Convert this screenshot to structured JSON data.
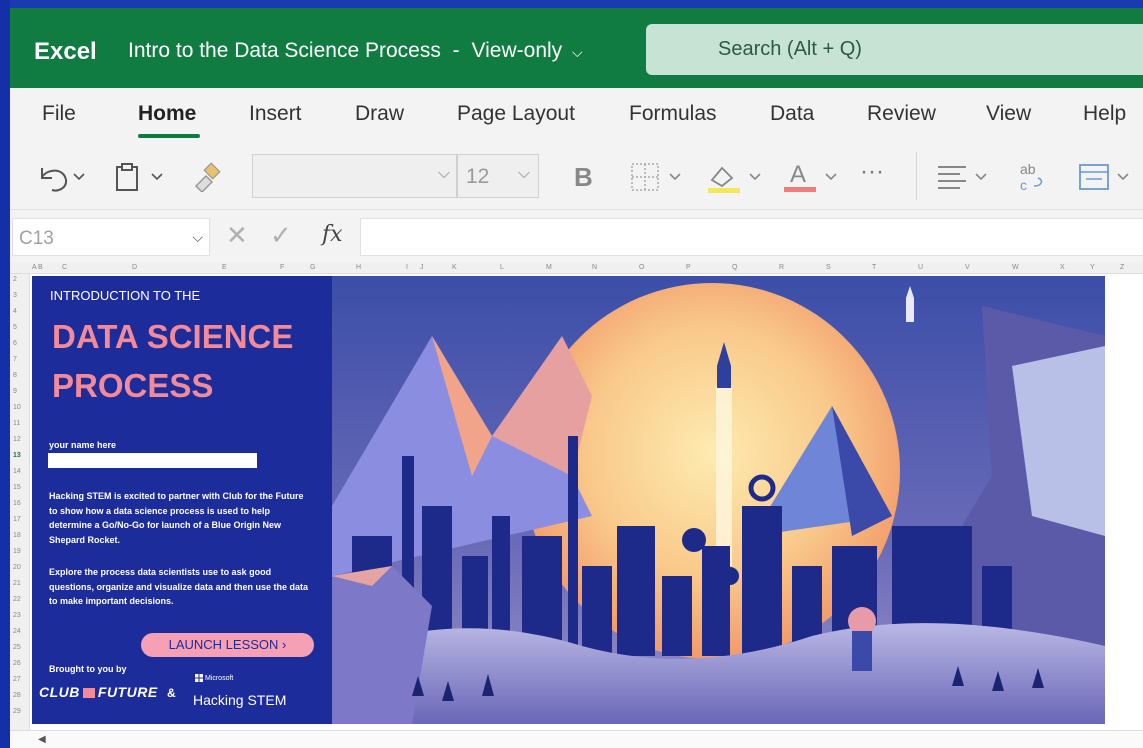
{
  "app": {
    "name": "Excel",
    "doc_title": "Intro to the Data Science Process",
    "separator": "-",
    "mode": "View-only"
  },
  "search": {
    "placeholder": "Search (Alt + Q)"
  },
  "tabs": [
    "File",
    "Home",
    "Insert",
    "Draw",
    "Page Layout",
    "Formulas",
    "Data",
    "Review",
    "View",
    "Help"
  ],
  "active_tab": "Home",
  "toolbar": {
    "font_size": "12",
    "bold": "B",
    "more": "···",
    "wrap_icon_text": "ab"
  },
  "formula_bar": {
    "cell_ref": "C13",
    "fx": "fx",
    "value": ""
  },
  "columns": [
    "A",
    "B",
    "C",
    "D",
    "E",
    "F",
    "G",
    "H",
    "I",
    "J",
    "K",
    "L",
    "M",
    "N",
    "O",
    "P",
    "Q",
    "R",
    "S",
    "T",
    "U",
    "V",
    "W",
    "X",
    "Y",
    "Z"
  ],
  "rows": [
    "2",
    "3",
    "4",
    "5",
    "6",
    "7",
    "8",
    "9",
    "10",
    "11",
    "12",
    "13",
    "14",
    "15",
    "16",
    "17",
    "18",
    "19",
    "20",
    "21",
    "22",
    "23",
    "24",
    "25",
    "26",
    "27",
    "28",
    "29"
  ],
  "lesson": {
    "intro": "INTRODUCTION TO THE",
    "title_line1": "DATA SCIENCE",
    "title_line2": "PROCESS",
    "name_label": "your name here",
    "para1": "Hacking STEM is excited to partner with Club for the Future to show how a data science process is used to help determine a Go/No-Go for launch of a Blue Origin New Shepard Rocket.",
    "para2": "Explore the process data scientists use to ask good questions, organize and visualize data and then use the data to make important decisions.",
    "launch": "LAUNCH LESSON",
    "brought": "Brought to you by",
    "club_left": "CLUB",
    "club_right": "FUTURE",
    "amp": "&",
    "ms": "Microsoft",
    "hs": "Hacking STEM"
  },
  "colors": {
    "excel_green": "#107c41",
    "panel_blue": "#1d2c9b",
    "accent_pink": "#f48a98"
  }
}
